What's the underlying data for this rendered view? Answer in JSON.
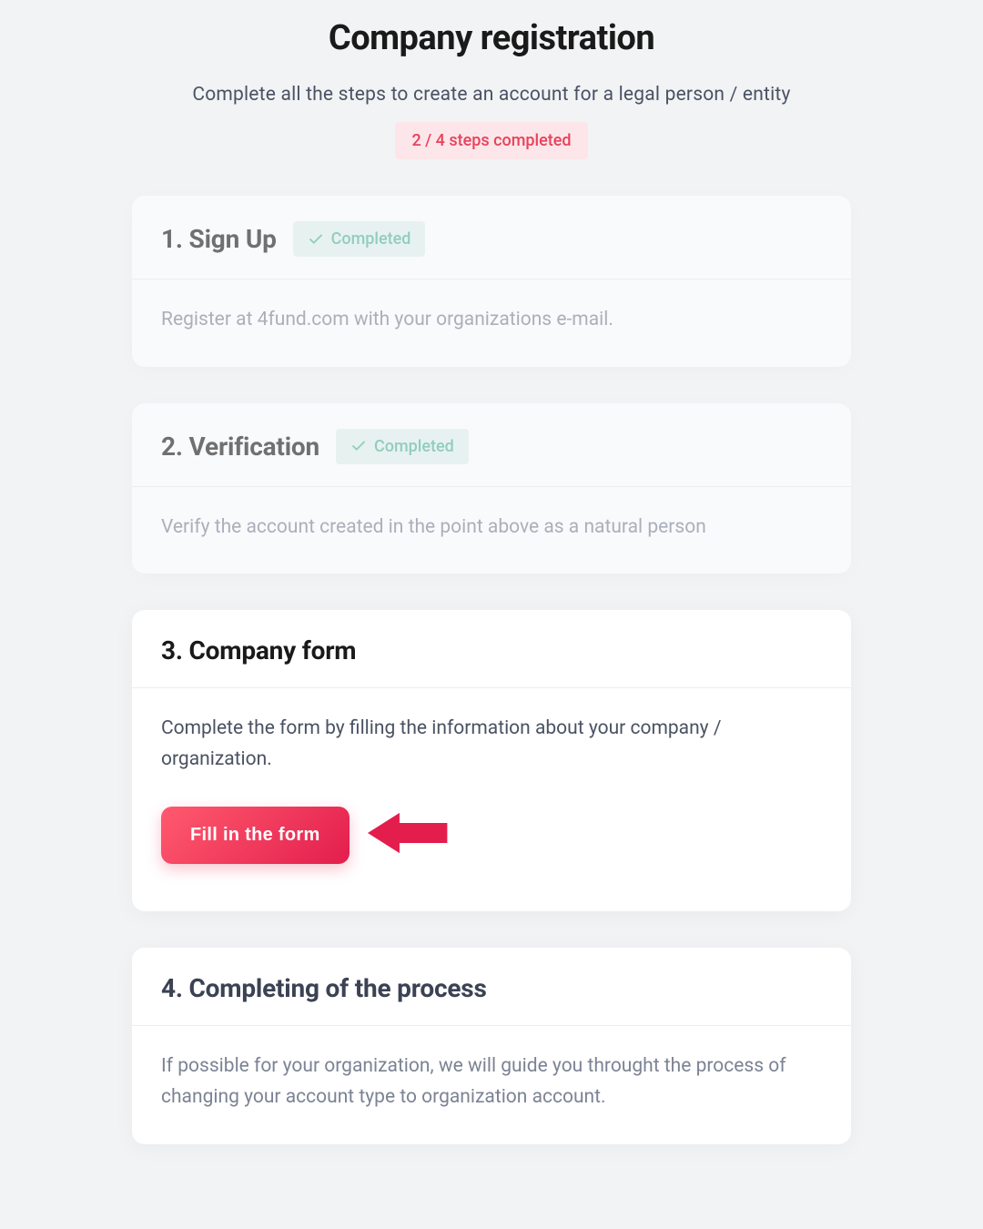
{
  "header": {
    "title": "Company registration",
    "subtitle": "Complete all the steps to create an account for a legal person / entity",
    "progress_label": "2 / 4 steps completed"
  },
  "completed_label": "Completed",
  "steps": {
    "signup": {
      "title": "1. Sign Up",
      "description": "Register at 4fund.com with your organizations e-mail.",
      "completed": true
    },
    "verification": {
      "title": "2. Verification",
      "description": "Verify the account created in the point above as a natural person",
      "completed": true
    },
    "company_form": {
      "title": "3. Company form",
      "description": "Complete the form by filling the information about your company / organization.",
      "button_label": "Fill in the form",
      "completed": false
    },
    "completing": {
      "title": "4. Completing of the process",
      "description": "If possible for your organization, we will guide you throught the process of changing your account type to organization account.",
      "completed": false
    }
  }
}
